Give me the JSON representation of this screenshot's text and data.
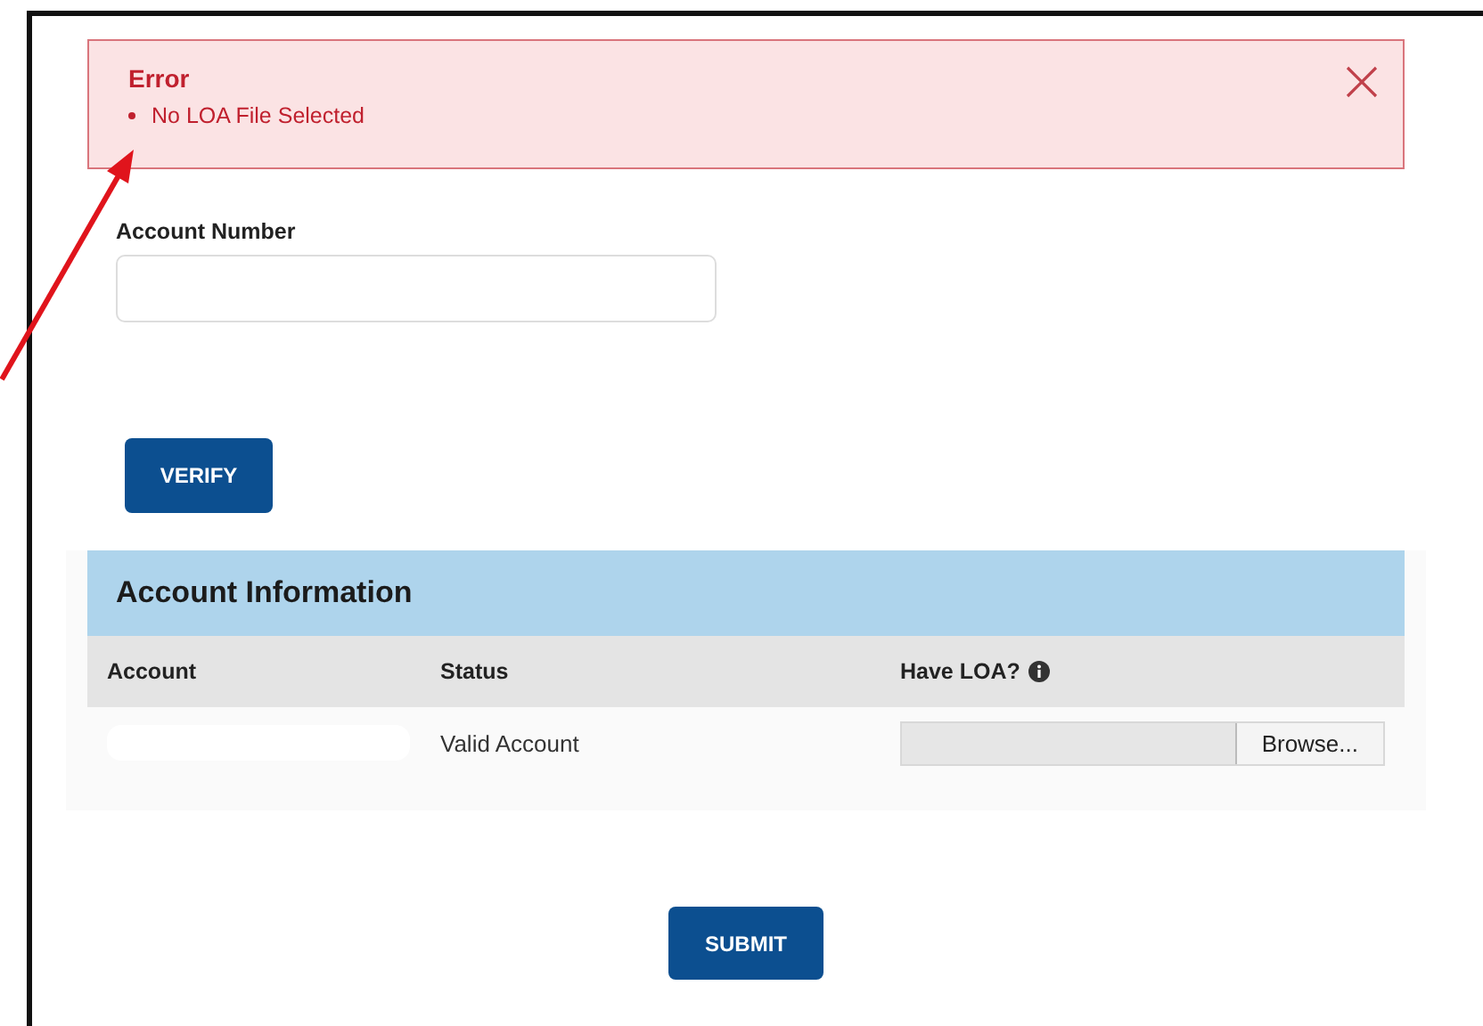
{
  "alert": {
    "title": "Error",
    "messages": [
      "No LOA File Selected"
    ],
    "dismissible": true
  },
  "account_number": {
    "label": "Account Number"
  },
  "verify_button": "VERIFY",
  "account_info": {
    "title": "Account Information",
    "columns": [
      {
        "label": "Account",
        "info": false
      },
      {
        "label": "Status",
        "info": false
      },
      {
        "label": "Have LOA?",
        "info": true
      }
    ],
    "rows": [
      {
        "status": "Valid Account",
        "browse_button": "Browse..."
      }
    ]
  },
  "submit_button": "SUBMIT"
}
